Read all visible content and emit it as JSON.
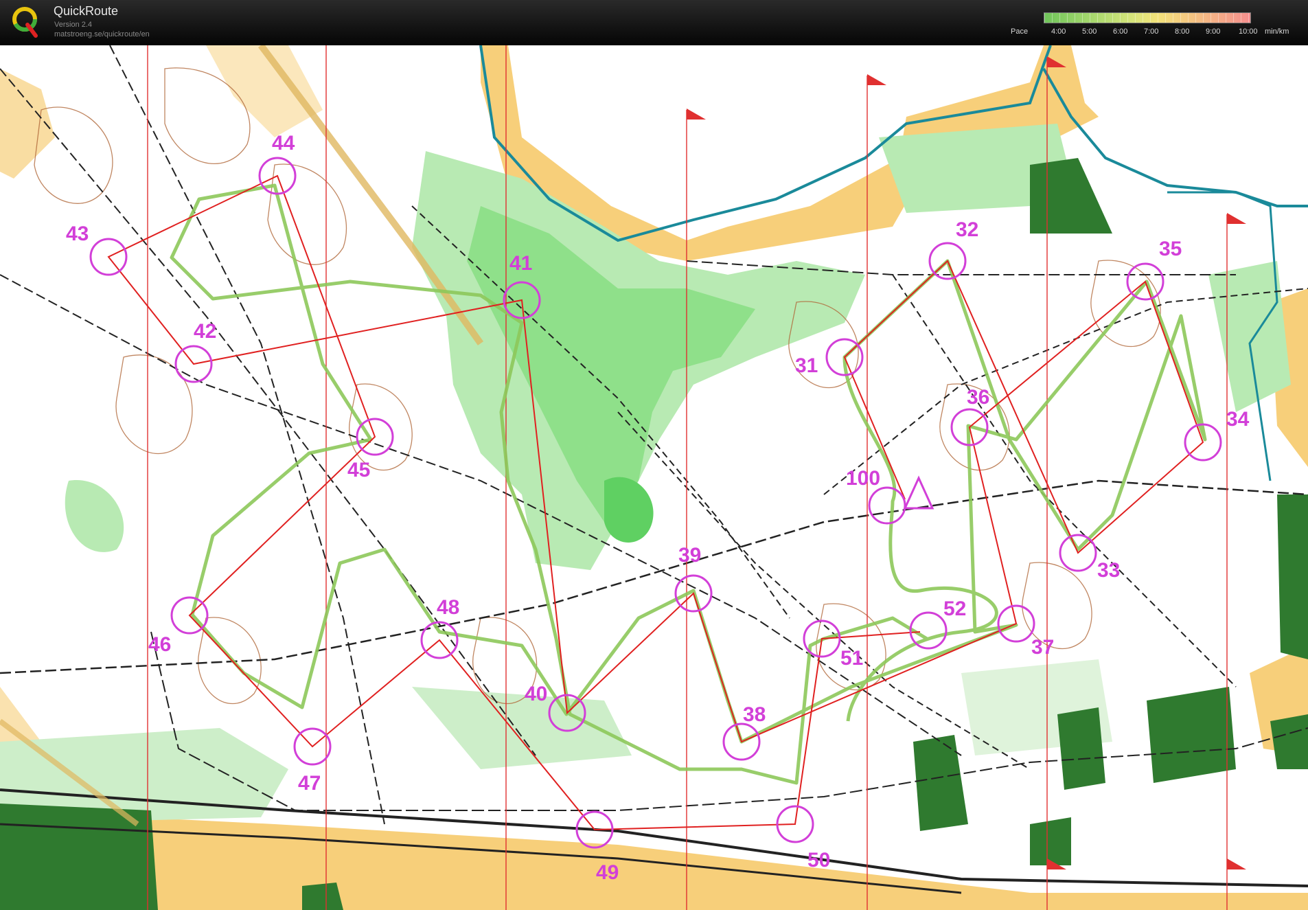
{
  "app": {
    "name": "QuickRoute",
    "version": "Version 2.4",
    "url": "matstroeng.se/quickroute/en"
  },
  "pace_legend": {
    "title": "Pace",
    "labels": [
      "4:00",
      "5:00",
      "6:00",
      "7:00",
      "8:00",
      "9:00",
      "10:00"
    ],
    "unit": "min/km",
    "colors": [
      "#6fc45a",
      "#9fd66b",
      "#d4e47a",
      "#f3e27a",
      "#f5b884",
      "#f58e8e"
    ]
  },
  "colors": {
    "control": "#d23fd8",
    "course_line": "#e02020",
    "route": "#8dc85a",
    "north_line": "#e03030",
    "water": "#1a8a9a",
    "open_land": "#f7cf7a",
    "vegetation": "#8fe08a",
    "settlement": "#2f7a2f"
  },
  "course": {
    "start_symbol": "triangle",
    "controls": [
      {
        "num": "31"
      },
      {
        "num": "32"
      },
      {
        "num": "33"
      },
      {
        "num": "34"
      },
      {
        "num": "35"
      },
      {
        "num": "36"
      },
      {
        "num": "37"
      },
      {
        "num": "38"
      },
      {
        "num": "39"
      },
      {
        "num": "40"
      },
      {
        "num": "41"
      },
      {
        "num": "42"
      },
      {
        "num": "43"
      },
      {
        "num": "44"
      },
      {
        "num": "45"
      },
      {
        "num": "46"
      },
      {
        "num": "47"
      },
      {
        "num": "48"
      },
      {
        "num": "49"
      },
      {
        "num": "50"
      },
      {
        "num": "51"
      },
      {
        "num": "52"
      },
      {
        "num": "100"
      }
    ]
  }
}
